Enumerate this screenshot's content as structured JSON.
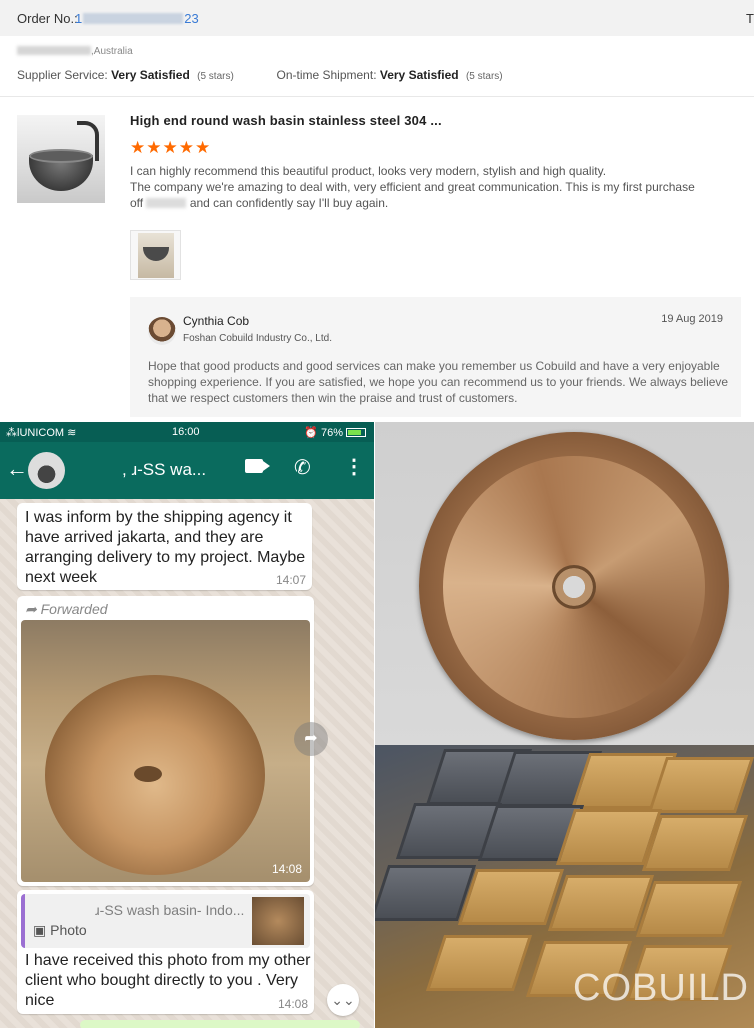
{
  "order": {
    "label": "Order No.:",
    "number_start": "1",
    "number_end": "23",
    "trail": "T"
  },
  "buyer": {
    "location": ",Australia"
  },
  "ratings": {
    "supplier_label": "Supplier Service:",
    "supplier_value": "Very Satisfied",
    "supplier_stars": "(5 stars)",
    "shipment_label": "On-time Shipment:",
    "shipment_value": "Very Satisfied",
    "shipment_stars": "(5 stars)"
  },
  "review": {
    "product_title": "High end round wash basin stainless steel 304 ...",
    "stars": "★★★★★",
    "line1": "I can highly recommend this beautiful product, looks very modern, stylish and high quality.",
    "line2": "The company we're amazing to deal with, very efficient and great communication. This is my first purchase",
    "line3_start": "off",
    "line3_end": "and can confidently say I'll buy again."
  },
  "reply": {
    "name": "Cynthia Cob",
    "company": "Foshan Cobuild Industry Co., Ltd.",
    "date": "19 Aug 2019",
    "text": "Hope that good products and good services can make you remember us Cobuild and have a very enjoyable shopping experience. If you are satisfied, we hope you can recommend us to your friends. We always believe that we respect customers then win the praise and trust of customers."
  },
  "phone": {
    "carrier": "UNICOM",
    "time": "16:00",
    "battery": "76%",
    "chat_title": ", ɹ-SS wa...",
    "messages": [
      {
        "text": "I was inform by the shipping agency it have arrived jakarta, and they are arranging delivery to my project. Maybe next week",
        "time": "14:07"
      },
      {
        "forwarded": "Forwarded",
        "time": "14:08"
      },
      {
        "quote_title": "ɹ-SS wash basin- Indo...",
        "quote_type": "Photo",
        "text": "I have received this photo from my other client who bought directly to you . Very nice",
        "time": "14:08"
      }
    ]
  },
  "watermark": "COBUILD",
  "icons": {
    "back": "back-arrow-icon",
    "video": "video-call-icon",
    "call": "phone-call-icon",
    "more": "more-vert-icon",
    "share": "share-icon",
    "scroll": "scroll-down-icon"
  }
}
